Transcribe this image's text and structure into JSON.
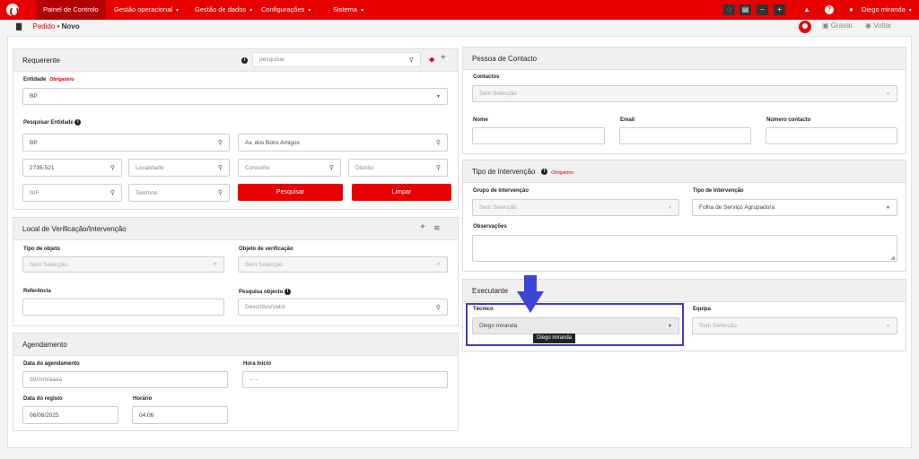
{
  "nav": {
    "items": [
      "Painel de Controlo",
      "Gestão operacional",
      "Gestão de dados",
      "Configurações",
      "Sistema"
    ],
    "user": "Diego miranda"
  },
  "breadcrumb": {
    "parent": "Pedido",
    "sep": "•",
    "current": "Novo"
  },
  "actions": {
    "save": "Gravar",
    "back": "Voltar"
  },
  "requerente": {
    "title": "Requerente",
    "search_placeholder": "pesquisar",
    "entidade_label": "Entidade",
    "required": "Obrigatório",
    "entidade_value": "BP",
    "pesquisar_entidade_label": "Pesquisar Entidade",
    "fields": {
      "nome": "BP",
      "morada": "Av. dos Bons Amigos",
      "cp": "2735-521",
      "localidade": "Localidade",
      "concelho": "Concelho",
      "distrito": "Distrito",
      "nif": "NIF",
      "telefone": "Telefone"
    },
    "btn_search": "Pesquisar",
    "btn_clear": "Limpar"
  },
  "local": {
    "title": "Local de Verificação/Intervenção",
    "tipo_label": "Tipo de objeto",
    "tipo_value": "Sem Selecção",
    "objeto_label": "Objeto de verificação",
    "objeto_value": "Sem Selecção",
    "referencia_label": "Referência",
    "pesquisa_label": "Pesquisa objecto",
    "pesquisa_placeholder": "Descritivo/Valor"
  },
  "agendamento": {
    "title": "Agendamento",
    "data_label": "Data do agendamento",
    "data_placeholder": "dd/mm/aaaa",
    "hora_label": "Hora Início",
    "hora_placeholder": "--:--",
    "registo_label": "Data do registo",
    "registo_value": "06/06/2025",
    "horario_label": "Horário",
    "horario_value": "04:06"
  },
  "contacto": {
    "title": "Pessoa de Contacto",
    "contactos_label": "Contactos",
    "contactos_value": "Sem Selecção",
    "nome_label": "Nome",
    "email_label": "Email",
    "numero_label": "Número contacto"
  },
  "intervencao": {
    "title": "Tipo de Intervenção",
    "required": "Obrigatório",
    "grupo_label": "Grupo de Intervenção",
    "grupo_value": "Sem Selecção",
    "tipo_label": "Tipo de Intervenção",
    "tipo_value": "Folha de Serviço Agrupadora",
    "obs_label": "Observações"
  },
  "executante": {
    "title": "Executante",
    "tecnico_label": "Técnico",
    "tecnico_value": "Diego miranda",
    "equipa_label": "Equipa",
    "equipa_value": "Sem Selecção",
    "tooltip": "Diego miranda"
  }
}
